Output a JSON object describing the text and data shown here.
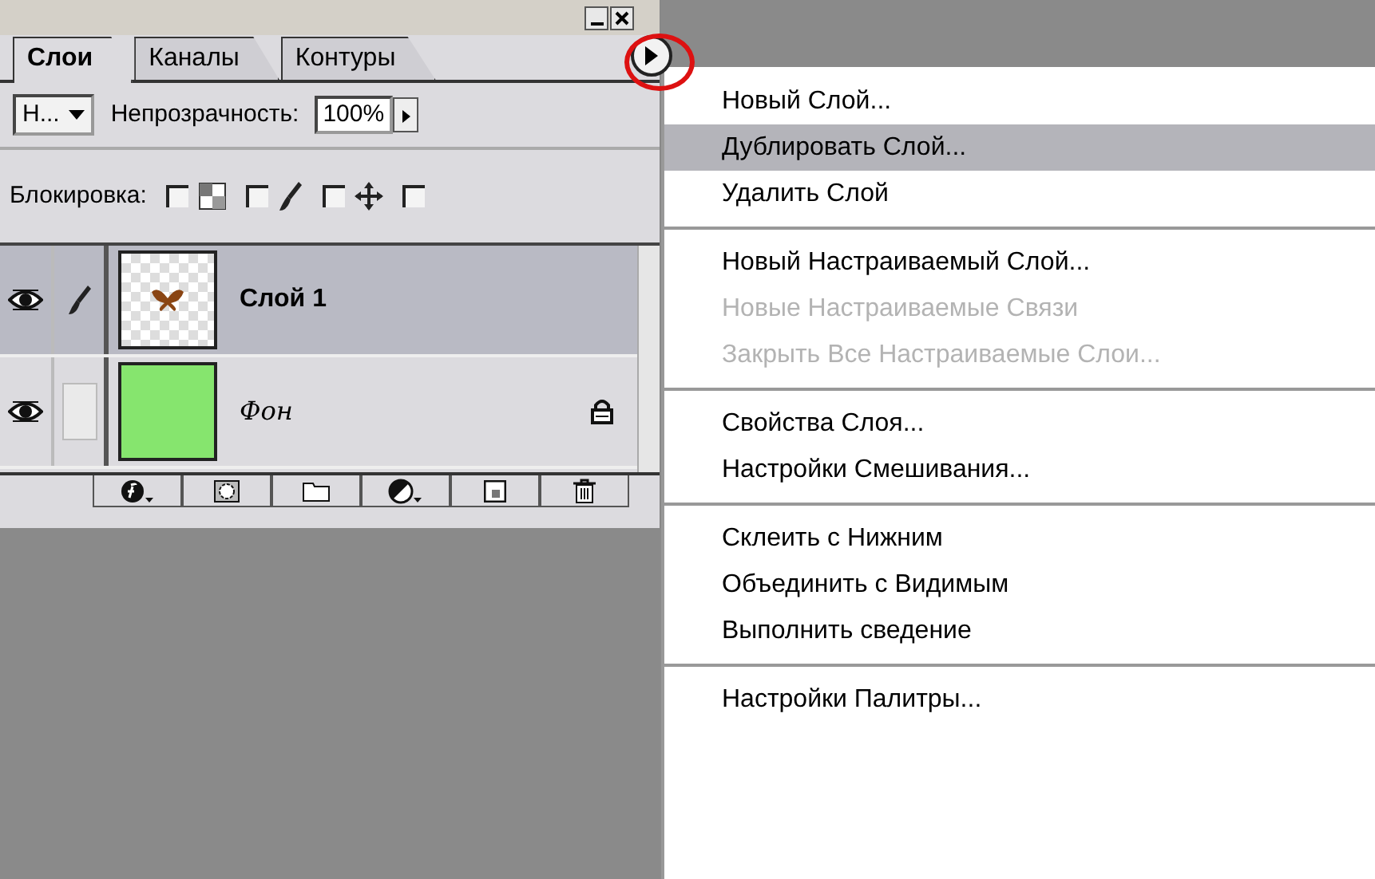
{
  "panel": {
    "tabs": [
      {
        "label": "Слои",
        "selected": true
      },
      {
        "label": "Каналы",
        "selected": false
      },
      {
        "label": "Контуры",
        "selected": false
      }
    ],
    "blend_mode": "Н...",
    "opacity_label": "Непрозрачность:",
    "opacity_value": "100%",
    "lock_label": "Блокировка:",
    "locks": [
      {
        "kind": "transparency",
        "checked": false
      },
      {
        "kind": "paint",
        "checked": false
      },
      {
        "kind": "move",
        "checked": false
      },
      {
        "kind": "all",
        "checked": false
      }
    ],
    "layers": [
      {
        "name": "Слой 1",
        "kind": "image",
        "visible": true,
        "paint": true,
        "locked": false,
        "background": false,
        "selected": true
      },
      {
        "name": "Фон",
        "kind": "fill",
        "visible": true,
        "paint": false,
        "locked": true,
        "background": true,
        "selected": false
      }
    ],
    "tools": [
      {
        "kind": "style"
      },
      {
        "kind": "mask"
      },
      {
        "kind": "folder"
      },
      {
        "kind": "adjust"
      },
      {
        "kind": "new"
      },
      {
        "kind": "trash"
      }
    ]
  },
  "menu": {
    "items": [
      {
        "label": "Новый Слой...",
        "disabled": false,
        "selected": false,
        "separator_after": false
      },
      {
        "label": "Дублировать Слой...",
        "disabled": false,
        "selected": true,
        "separator_after": false
      },
      {
        "label": "Удалить Слой",
        "disabled": false,
        "selected": false,
        "separator_after": true
      },
      {
        "label": "Новый Настраиваемый Слой...",
        "disabled": false,
        "selected": false,
        "separator_after": false
      },
      {
        "label": "Новые Настраиваемые Связи",
        "disabled": true,
        "selected": false,
        "separator_after": false
      },
      {
        "label": "Закрыть Все Настраиваемые Слои...",
        "disabled": true,
        "selected": false,
        "separator_after": true
      },
      {
        "label": "Свойства Слоя...",
        "disabled": false,
        "selected": false,
        "separator_after": false
      },
      {
        "label": "Настройки Смешивания...",
        "disabled": false,
        "selected": false,
        "separator_after": true
      },
      {
        "label": "Склеить с Нижним",
        "disabled": false,
        "selected": false,
        "separator_after": false
      },
      {
        "label": "Объединить с Видимым",
        "disabled": false,
        "selected": false,
        "separator_after": false
      },
      {
        "label": "Выполнить сведение",
        "disabled": false,
        "selected": false,
        "separator_after": true
      },
      {
        "label": "Настройки Палитры...",
        "disabled": false,
        "selected": false,
        "separator_after": false
      }
    ]
  }
}
